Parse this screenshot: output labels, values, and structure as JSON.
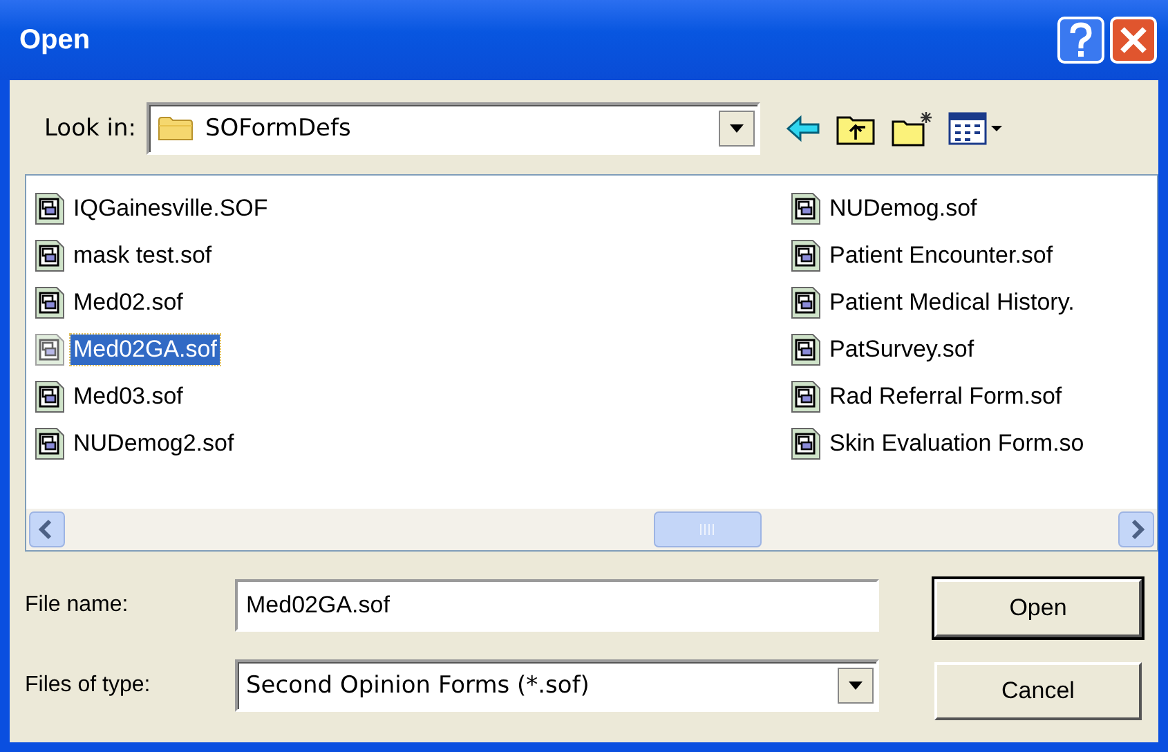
{
  "window": {
    "title": "Open"
  },
  "look_in": {
    "label": "Look in:",
    "value": "SOFormDefs"
  },
  "files": [
    {
      "name": "IQGainesville.SOF",
      "selected": false
    },
    {
      "name": "mask test.sof",
      "selected": false
    },
    {
      "name": "Med02.sof",
      "selected": false
    },
    {
      "name": "Med02GA.sof",
      "selected": true
    },
    {
      "name": "Med03.sof",
      "selected": false
    },
    {
      "name": "NUDemog2.sof",
      "selected": false
    },
    {
      "name": "NUDemog.sof",
      "selected": false
    },
    {
      "name": "Patient Encounter.sof",
      "selected": false
    },
    {
      "name": "Patient Medical History.",
      "selected": false
    },
    {
      "name": "PatSurvey.sof",
      "selected": false
    },
    {
      "name": "Rad Referral Form.sof",
      "selected": false
    },
    {
      "name": "Skin Evaluation Form.so",
      "selected": false
    }
  ],
  "file_name": {
    "label": "File name:",
    "value": "Med02GA.sof"
  },
  "file_type": {
    "label": "Files of type:",
    "value": "Second Opinion Forms (*.sof)"
  },
  "buttons": [
    "Open",
    "Cancel"
  ]
}
